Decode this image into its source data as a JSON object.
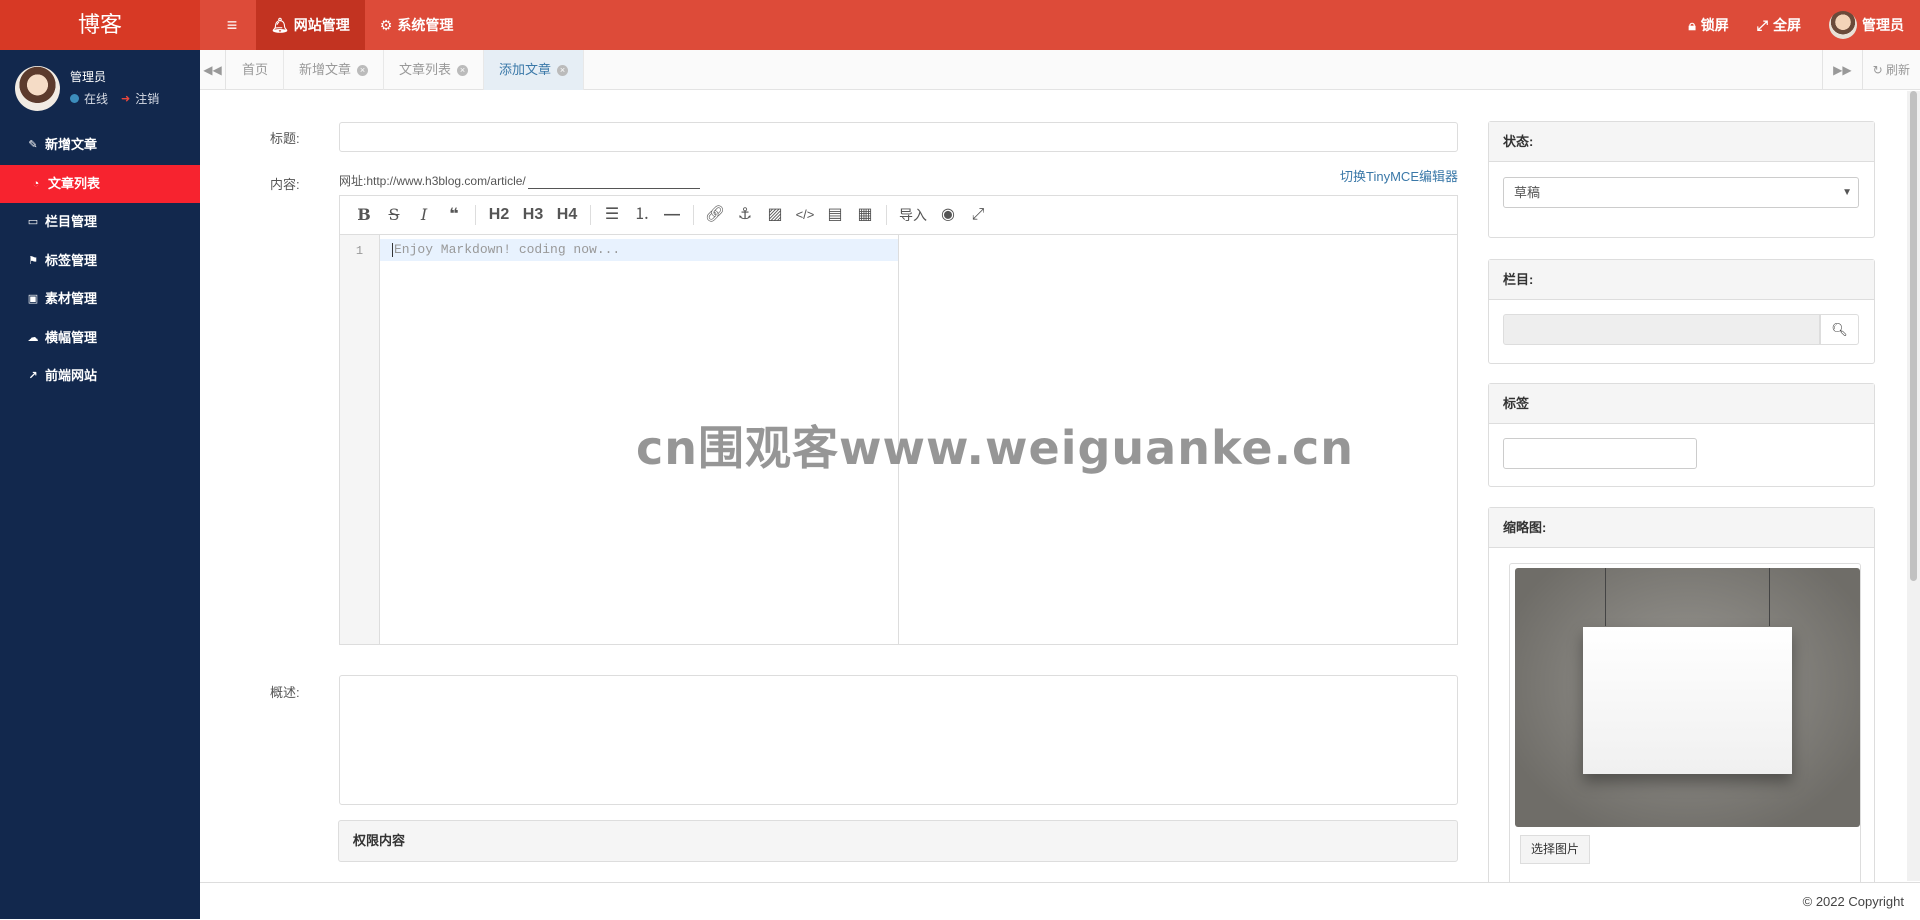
{
  "header": {
    "logo": "博客",
    "menu_icon": "≡",
    "nav": [
      {
        "label": "网站管理",
        "icon": "bell-icon"
      },
      {
        "label": "系统管理",
        "icon": "gear-icon"
      }
    ],
    "lock_label": "锁屏",
    "fullscreen_label": "全屏",
    "user_label": "管理员"
  },
  "sidebar": {
    "user_name": "管理员",
    "status_label": "在线",
    "logout_label": "注销",
    "items": [
      {
        "label": "新增文章",
        "icon": "pencil-icon"
      },
      {
        "label": "文章列表",
        "icon": "dashboard-icon"
      },
      {
        "label": "栏目管理",
        "icon": "folder-icon"
      },
      {
        "label": "标签管理",
        "icon": "flag-icon"
      },
      {
        "label": "素材管理",
        "icon": "image-icon"
      },
      {
        "label": "横幅管理",
        "icon": "cloud-icon"
      },
      {
        "label": "前端网站",
        "icon": "external-link-icon"
      }
    ]
  },
  "tabs": {
    "items": [
      {
        "label": "首页"
      },
      {
        "label": "新增文章"
      },
      {
        "label": "文章列表"
      },
      {
        "label": "添加文章"
      }
    ],
    "refresh_label": "刷新"
  },
  "form": {
    "title_label": "标题:",
    "content_label": "内容:",
    "url_prefix": "网址:http://www.h3blog.com/article/",
    "switch_editor": "切换TinyMCE编辑器",
    "toolbar": {
      "h2": "H2",
      "h3": "H3",
      "h4": "H4",
      "import": "导入"
    },
    "line_number": "1",
    "editor_placeholder": "Enjoy Markdown! coding now...",
    "summary_label": "概述:",
    "permission_label": "权限内容"
  },
  "side_panels": {
    "status_title": "状态:",
    "status_value": "草稿",
    "category_title": "栏目:",
    "tags_title": "标签",
    "thumb_title": "缩略图:",
    "pick_image": "选择图片"
  },
  "watermark": "cn围观客www.weiguanke.cn",
  "footer": {
    "copyright": "© 2022 Copyright"
  },
  "colors": {
    "header": "#dd4b39",
    "sidebar": "#12284d",
    "active_item": "#f7232f",
    "link": "#3a78a8"
  }
}
